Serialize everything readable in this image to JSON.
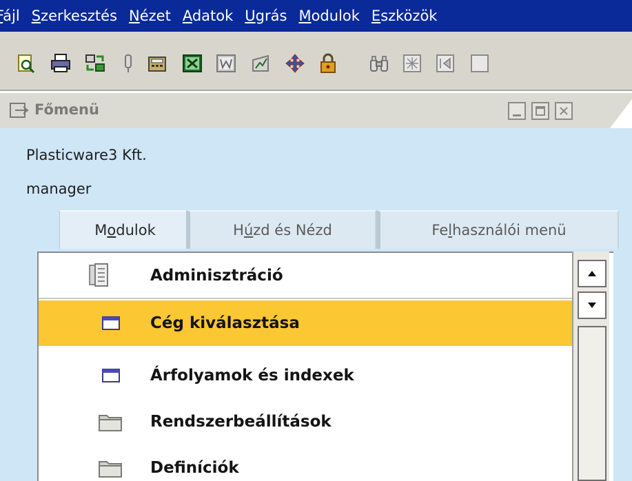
{
  "menubar": {
    "items": [
      {
        "accel": "F",
        "rest": "ájl"
      },
      {
        "accel": "S",
        "rest": "zerkesztés"
      },
      {
        "accel": "N",
        "rest": "ézet"
      },
      {
        "accel": "A",
        "rest": "datok"
      },
      {
        "accel": "U",
        "rest": "grás"
      },
      {
        "accel": "M",
        "rest": "odulok"
      },
      {
        "accel": "E",
        "rest": "szközök"
      }
    ]
  },
  "toolbar": {
    "icons": [
      "print-preview-icon",
      "print-icon",
      "transfer-icon",
      "pin-icon",
      "calculator-icon",
      "excel-icon",
      "word-icon",
      "chart-icon",
      "navigate-icon",
      "lock-icon",
      "binoculars-icon",
      "grid-icon",
      "rewind-icon",
      "more-icon"
    ]
  },
  "window": {
    "title": "Főmenü"
  },
  "session": {
    "company": "Plasticware3 Kft.",
    "user": "manager"
  },
  "tabs": [
    {
      "pre": "M",
      "accel": "o",
      "post": "dulok"
    },
    {
      "pre": "H",
      "accel": "ú",
      "post": "zd és Nézd"
    },
    {
      "pre": "Fe",
      "accel": "l",
      "post": "használói menü"
    }
  ],
  "tree": {
    "header": "Adminisztráció",
    "items": [
      {
        "label": "Cég kiválasztása",
        "icon": "window-icon",
        "selected": true
      },
      {
        "label": "Árfolyamok és indexek",
        "icon": "window-icon",
        "selected": false
      },
      {
        "label": "Rendszerbeállítások",
        "icon": "folder-icon",
        "selected": false
      },
      {
        "label": "Definíciók",
        "icon": "folder-icon",
        "selected": false
      }
    ]
  },
  "colors": {
    "menubar": "#0a2a9a",
    "selection": "#fbc732",
    "content_bg": "#cfe6f7"
  }
}
